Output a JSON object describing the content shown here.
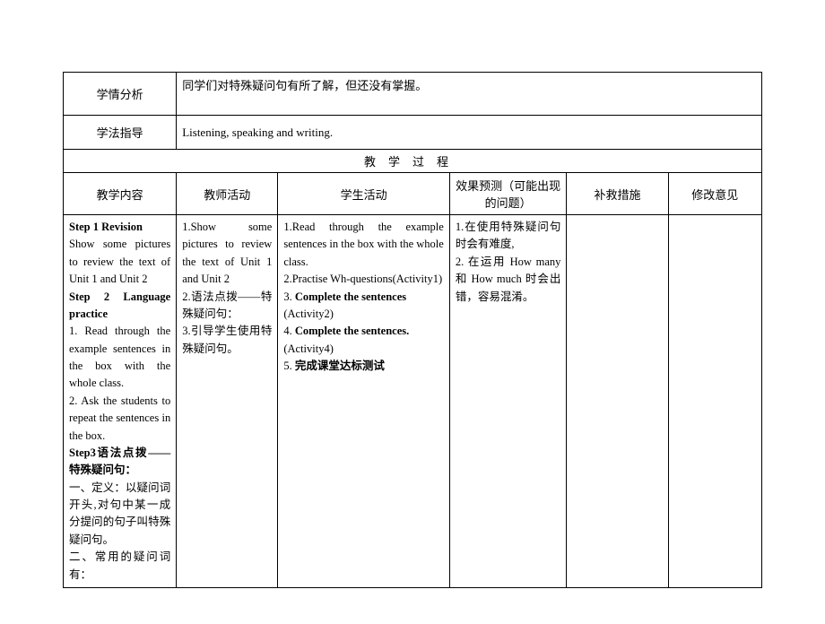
{
  "rows": {
    "analysis": {
      "label": "学情分析",
      "value": "同学们对特殊疑问句有所了解，但还没有掌握。"
    },
    "method": {
      "label": "学法指导",
      "value": "Listening, speaking and writing."
    }
  },
  "process_header": "教学过程",
  "columns": {
    "content": "教学内容",
    "teacher": "教师活动",
    "student": "学生活动",
    "prediction": "效果预测（可能出现的问题）",
    "remedy": "补救措施",
    "revision": "修改意见"
  },
  "body": {
    "content": {
      "step1_title": "Step 1 Revision",
      "step1_text": "Show some pictures to review the text of Unit 1 and Unit 2",
      "step2_title": "Step 2 Language practice",
      "step2_item1": "1. Read through the example sentences in the box with the whole class.",
      "step2_item2": "2. Ask the students to repeat the sentences in the box.",
      "step3_title": "Step3语法点拨——特殊疑问句：",
      "step3_item1": "一、定义：以疑问词开头,对句中某一成分提问的句子叫特殊疑问句。",
      "step3_item2": "二、常用的疑问词有："
    },
    "teacher": {
      "t1": "1.Show some pictures to review the text of Unit 1 and Unit 2",
      "t2": "2.语法点拨——特殊疑问句：",
      "t3": "3.引导学生使用特殊疑问句。"
    },
    "student": {
      "s1": "1.Read through the example sentences in the box with the whole class.",
      "s2": "2.Practise Wh-questions(Activity1)",
      "s3a": "3. ",
      "s3b": "Complete the sentences",
      "s3c": "(Activity2)",
      "s4a": "4. ",
      "s4b": "Complete the sentences.",
      "s4c": "(Activity4)",
      "s5a": "5. ",
      "s5b": "完成课堂达标测试"
    },
    "prediction": {
      "p1": "1.在使用特殊疑问句时会有难度,",
      "p2": "2. 在运用 How many 和 How much 时会出错，容易混淆。"
    },
    "remedy": "",
    "revision": ""
  }
}
